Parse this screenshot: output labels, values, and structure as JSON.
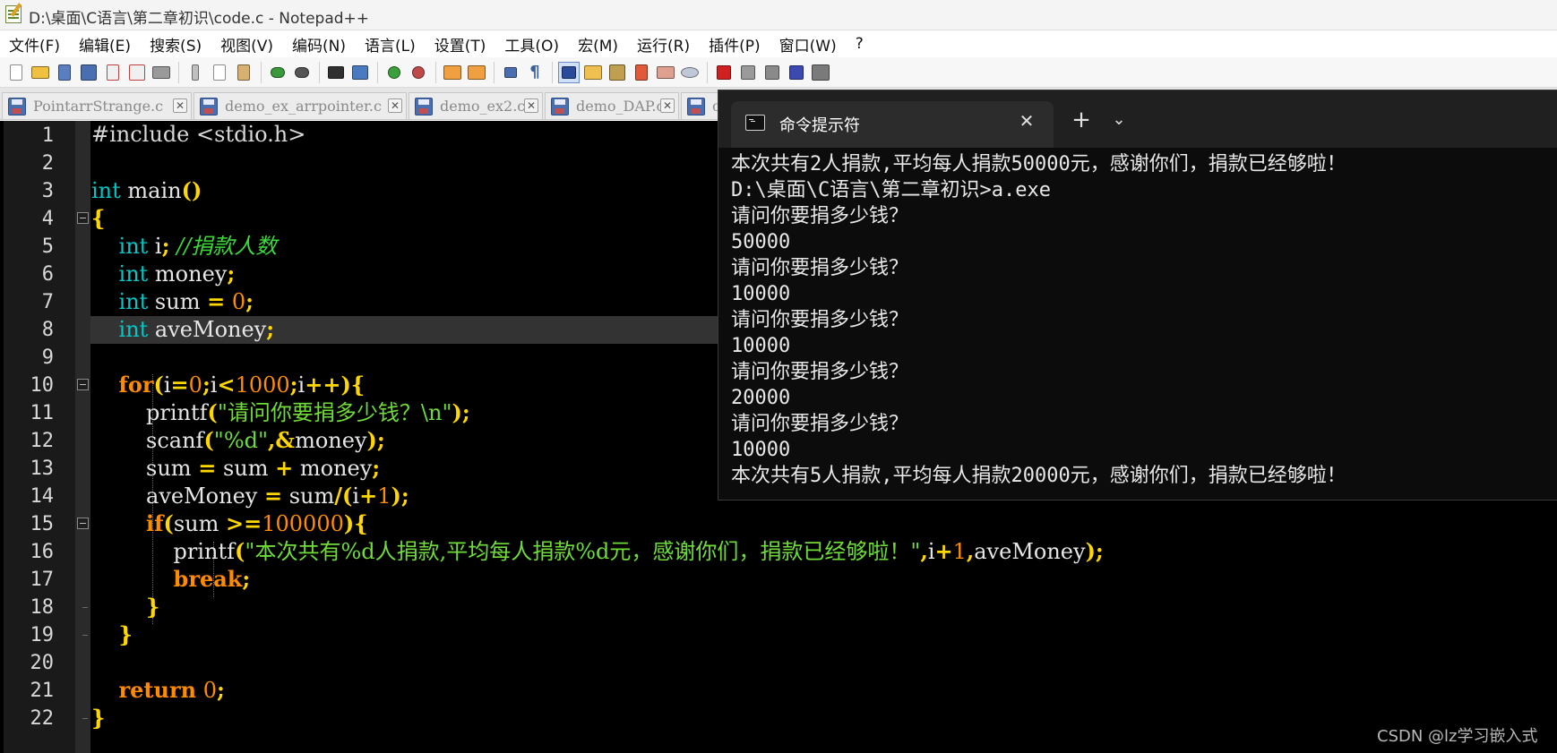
{
  "window": {
    "title": "D:\\桌面\\C语言\\第二章初识\\code.c - Notepad++"
  },
  "menu": [
    "文件(F)",
    "编辑(E)",
    "搜索(S)",
    "视图(V)",
    "编码(N)",
    "语言(L)",
    "设置(T)",
    "工具(O)",
    "宏(M)",
    "运行(R)",
    "插件(P)",
    "窗口(W)",
    "?"
  ],
  "tabs": [
    {
      "label": "PointarrStrange.c"
    },
    {
      "label": "demo_ex_arrpointer.c"
    },
    {
      "label": "demo_ex2.c"
    },
    {
      "label": "demo_DAP.c"
    },
    {
      "label": "c"
    }
  ],
  "editor": {
    "line_numbers": [
      "1",
      "2",
      "3",
      "4",
      "5",
      "6",
      "7",
      "8",
      "9",
      "10",
      "11",
      "12",
      "13",
      "14",
      "15",
      "16",
      "17",
      "18",
      "19",
      "20",
      "21",
      "22"
    ],
    "current_line": 8
  },
  "console": {
    "tab_title": "命令提示符",
    "lines": [
      "本次共有2人捐款,平均每人捐款50000元，感谢你们，捐款已经够啦！",
      "D:\\桌面\\C语言\\第二章初识>a.exe",
      "请问你要捐多少钱？",
      "50000",
      "请问你要捐多少钱？",
      "10000",
      "请问你要捐多少钱？",
      "10000",
      "请问你要捐多少钱？",
      "20000",
      "请问你要捐多少钱？",
      "10000",
      "本次共有5人捐款,平均每人捐款20000元，感谢你们，捐款已经够啦！"
    ]
  },
  "watermark": "CSDN @lz学习嵌入式",
  "colors": {
    "editor_bg": "#000000",
    "keyword_type": "#00c8c8",
    "keyword_control": "#ff8c00",
    "operator": "#ffd700",
    "string": "#6fdc3a",
    "number": "#ff8c00",
    "comment": "#3bd93b"
  },
  "toolbar_icons": [
    "new-file-icon",
    "open-file-icon",
    "save-icon",
    "save-all-icon",
    "close-icon",
    "close-all-icon",
    "print-icon",
    "cut-icon",
    "copy-icon",
    "paste-icon",
    "undo-icon",
    "redo-icon",
    "find-icon",
    "replace-icon",
    "zoom-in-icon",
    "zoom-out-icon",
    "sync-vertical-icon",
    "sync-horizontal-icon",
    "word-wrap-icon",
    "show-all-chars-icon",
    "indent-guide-icon",
    "doc-map-icon",
    "function-list-icon",
    "folder-workspace-icon",
    "monitoring-icon",
    "record-macro-icon",
    "stop-macro-icon",
    "play-macro-icon",
    "run-macro-multiple-icon",
    "save-macro-icon"
  ]
}
